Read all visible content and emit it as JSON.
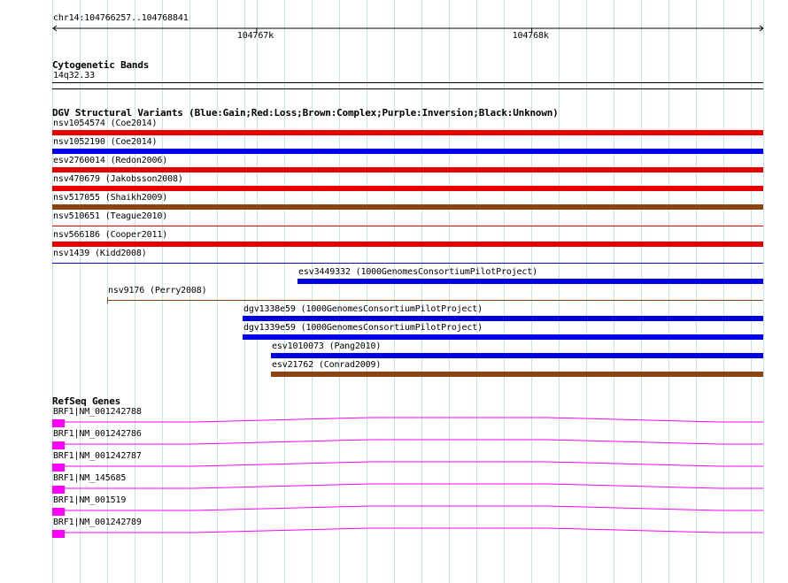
{
  "ruler": {
    "location": "chr14:104766257..104768841",
    "ticks": [
      {
        "label": "104767k",
        "pos": 104767000
      },
      {
        "label": "104768k",
        "pos": 104768000
      }
    ]
  },
  "cytoband": {
    "title": "Cytogenetic Bands",
    "band": "14q32.33"
  },
  "dgv": {
    "title": "DGV Structural Variants (Blue:Gain;Red:Loss;Brown:Complex;Purple:Inversion;Black:Unknown)",
    "colors": {
      "gain": "#0000e6",
      "loss": "#e60000",
      "complex": "#8b4513",
      "inversion": "#800080",
      "unknown": "#000000"
    },
    "features": [
      {
        "label": "nsv1054574 (Coe2014)",
        "type": "loss",
        "start": 104766257,
        "end": 104768841,
        "thin": false
      },
      {
        "label": "nsv1052190 (Coe2014)",
        "type": "gain",
        "start": 104766257,
        "end": 104768841,
        "thin": false
      },
      {
        "label": "esv2760014 (Redon2006)",
        "type": "loss",
        "start": 104766257,
        "end": 104768841,
        "thin": false
      },
      {
        "label": "nsv470679 (Jakobsson2008)",
        "type": "loss",
        "start": 104766257,
        "end": 104768841,
        "thin": false
      },
      {
        "label": "nsv517055 (Shaikh2009)",
        "type": "complex",
        "start": 104766257,
        "end": 104768841,
        "thin": false
      },
      {
        "label": "nsv510651 (Teague2010)",
        "type": "loss",
        "start": 104766257,
        "end": 104768841,
        "thin": true
      },
      {
        "label": "nsv566186 (Cooper2011)",
        "type": "loss",
        "start": 104766257,
        "end": 104768841,
        "thin": false
      },
      {
        "label": "nsv1439 (Kidd2008)",
        "type": "gain",
        "start": 104766257,
        "end": 104768841,
        "thin": true
      },
      {
        "label": "esv3449332 (1000GenomesConsortiumPilotProject)",
        "type": "gain",
        "start": 104767148,
        "end": 104768841,
        "thin": false
      },
      {
        "label": "nsv9176 (Perry2008)",
        "type": "complex",
        "start": 104766455,
        "end": 104768841,
        "thin": true
      },
      {
        "label": "dgv1338e59 (1000GenomesConsortiumPilotProject)",
        "type": "gain",
        "start": 104766950,
        "end": 104768841,
        "thin": false
      },
      {
        "label": "dgv1339e59 (1000GenomesConsortiumPilotProject)",
        "type": "gain",
        "start": 104766950,
        "end": 104768841,
        "thin": false
      },
      {
        "label": "esv1010073 (Pang2010)",
        "type": "gain",
        "start": 104767053,
        "end": 104768841,
        "thin": false
      },
      {
        "label": "esv21762 (Conrad2009)",
        "type": "complex",
        "start": 104767053,
        "end": 104768841,
        "thin": false
      }
    ]
  },
  "refseq": {
    "title": "RefSeq Genes",
    "color": "#ff00ff",
    "genes": [
      {
        "label": "BRF1|NM_001242788"
      },
      {
        "label": "BRF1|NM_001242786"
      },
      {
        "label": "BRF1|NM_001242787"
      },
      {
        "label": "BRF1|NM_145685"
      },
      {
        "label": "BRF1|NM_001519"
      },
      {
        "label": "BRF1|NM_001242789"
      }
    ]
  }
}
